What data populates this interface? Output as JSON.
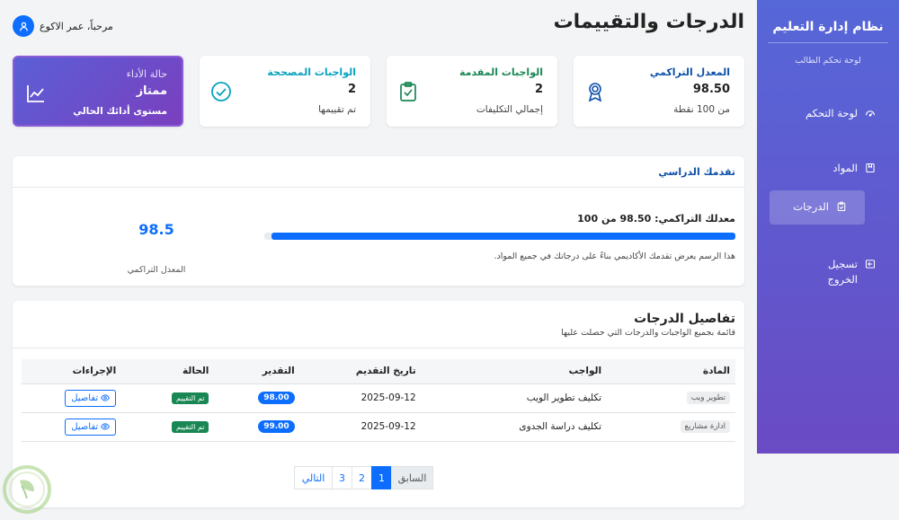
{
  "sidebar": {
    "title": "نظام إدارة التعليم",
    "subtitle": "لوحة تحكم الطالب",
    "items": [
      {
        "label": "لوحة التحكم",
        "icon": "dashboard-icon"
      },
      {
        "label": "المواد",
        "icon": "book-icon"
      },
      {
        "label": "الدرجات",
        "icon": "clipboard-icon",
        "active": true
      },
      {
        "label": "تسجيل الخروج",
        "icon": "logout-icon"
      }
    ]
  },
  "header": {
    "title": "الدرجات والتقييمات",
    "user_greeting": "مرحباً، عمر الاكوع"
  },
  "stats": [
    {
      "label": "المعدل التراكمي",
      "value": "98.50",
      "sub": "من 100 نقطة",
      "icon": "award-icon",
      "color": "#0d4fa8"
    },
    {
      "label": "الواجبات المقدمة",
      "value": "2",
      "sub": "إجمالي التكليفات",
      "icon": "clipboard-check-icon",
      "color": "#198754"
    },
    {
      "label": "الواجبات المصححة",
      "value": "2",
      "sub": "تم تقييمها",
      "icon": "check-circle-icon",
      "color": "#0aa2c0"
    },
    {
      "label": "حالة الأداء",
      "value": "ممتاز",
      "sub": "مستوى أدائك الحالي",
      "icon": "chart-line-icon"
    }
  ],
  "progress": {
    "header": "تقدمك الدراسي",
    "label": "معدلك التراكمي: 98.50 من 100",
    "percent": 98.5,
    "note": "هذا الرسم يعرض تقدمك الأكاديمي بناءً على درجاتك في جميع المواد.",
    "big_value": "98.5",
    "big_label": "المعدل التراكمي"
  },
  "grades": {
    "title": "تفاصيل الدرجات",
    "subtitle": "قائمة بجميع الواجبات والدرجات التي حصلت عليها",
    "columns": [
      "المادة",
      "الواجب",
      "تاريخ التقديم",
      "التقدير",
      "الحالة",
      "الإجراءات"
    ],
    "rows": [
      {
        "subject": "تطوير ويب",
        "assignment": "تكليف تطوير الويب",
        "date": "2025-09-12",
        "grade": "98.00",
        "status": "تم التقييم",
        "action": "تفاصيل"
      },
      {
        "subject": "ادارة مشاريع",
        "assignment": "تكليف دراسة الجدوى",
        "date": "2025-09-12",
        "grade": "99.00",
        "status": "تم التقييم",
        "action": "تفاصيل"
      }
    ]
  },
  "pagination": {
    "prev": "السابق",
    "pages": [
      "1",
      "2",
      "3"
    ],
    "active": "1",
    "next": "التالي"
  }
}
